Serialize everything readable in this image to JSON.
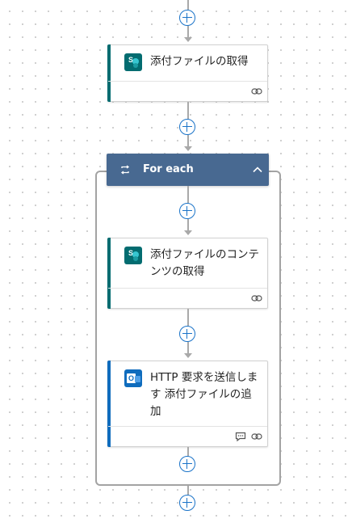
{
  "flow": {
    "steps": [
      {
        "title": "添付ファイルの取得",
        "app_icon": "sharepoint-icon",
        "footer_icons": [
          "link-icon"
        ]
      }
    ],
    "loop": {
      "label": "For each",
      "header_color": "#486991",
      "icon": "loop-icon",
      "collapse_icon": "chevron-up-icon",
      "actions": [
        {
          "title": "添付ファイルのコンテンツの取得",
          "app_icon": "sharepoint-icon",
          "footer_icons": [
            "link-icon"
          ]
        },
        {
          "title": "HTTP 要求を送信します 添付ファイルの追加",
          "app_icon": "outlook-icon",
          "footer_icons": [
            "comment-icon",
            "link-icon"
          ]
        }
      ]
    }
  },
  "colors": {
    "sharepoint_accent": "#036c70",
    "outlook_accent": "#0f6cbd",
    "add_button": "#1a73c8",
    "connector": "#a9a9a9"
  }
}
